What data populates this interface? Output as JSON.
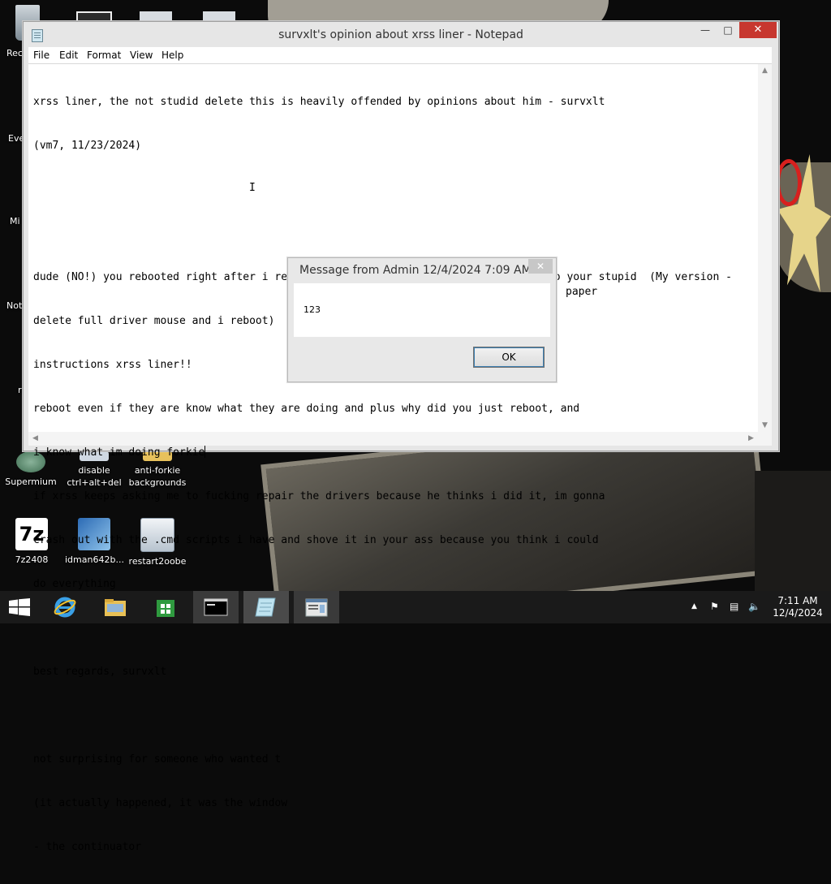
{
  "desktop": {
    "icons": [
      {
        "name": "recycle-bin",
        "label": "Rec"
      },
      {
        "name": "supermium",
        "label": "Supermium"
      },
      {
        "name": "disable-cad",
        "label": "disable ctrl+alt+del"
      },
      {
        "name": "anti-forkie",
        "label": "anti-forkie backgrounds"
      },
      {
        "name": "7z2408",
        "label": "7z2408"
      },
      {
        "name": "idman",
        "label": "idman642b..."
      },
      {
        "name": "restart2oobe",
        "label": "restart2oobe"
      }
    ],
    "partial_labels": [
      "Eve",
      "Mi",
      "Not",
      "r"
    ]
  },
  "notepad": {
    "title": "survxlt's opinion about xrss liner - Notepad",
    "menu": [
      "File",
      "Edit",
      "Format",
      "View",
      "Help"
    ],
    "lines": [
      "xrss liner, the not studid delete this is heavily offended by opinions about him - survxlt",
      "(vm7, 11/23/2024)",
      "",
      "",
      "dude (NO!) you rebooted right after i remove the driver, thats why i dont listen to your stupid  (My version -",
      "delete full driver mouse and i reboot)",
      "instructions xrss liner!!",
      "reboot even if they are know what they are doing and plus why did you just reboot, and",
      "i know what im doing forkie",
      "if xrss keeps asking me to fucking repair the drivers because he thinks i did it, im gonna",
      "crash out with the .cmd scripts i have and shove it in your ass because you think i could",
      "do everything",
      "",
      "best regards, survxlt",
      "",
      "not surprising for someone who wanted t",
      "(it actually happened, it was the window",
      "- the continuator"
    ],
    "line16_tail": "paper"
  },
  "message_box": {
    "title": "Message from Admin 12/4/2024 7:09 AM",
    "body": "123",
    "ok_label": "OK"
  },
  "taskbar": {
    "apps": [
      "start",
      "internet-explorer",
      "file-explorer",
      "store",
      "cmd",
      "notepad",
      "message"
    ],
    "time": "7:11 AM",
    "date": "12/4/2024"
  },
  "colors": {
    "close_red": "#c7372f",
    "taskbar": "#1a1a1a",
    "window_chrome": "#e6e6e6"
  }
}
